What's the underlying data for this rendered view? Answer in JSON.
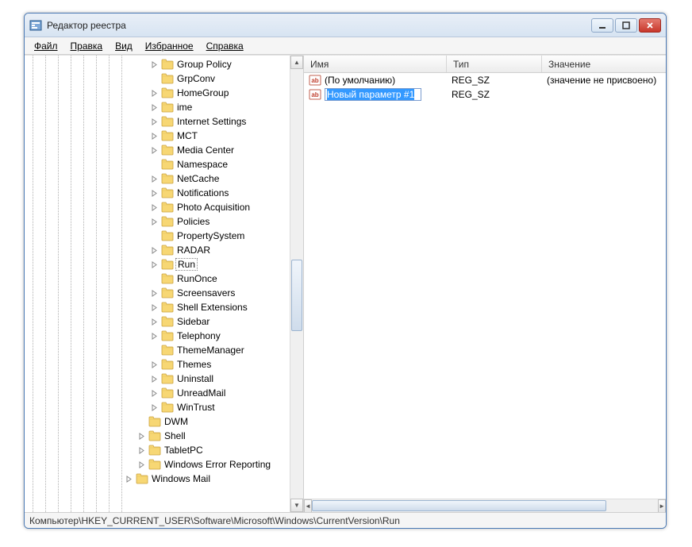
{
  "window": {
    "title": "Редактор реестра"
  },
  "menu": {
    "file": "Файл",
    "edit": "Правка",
    "view": "Вид",
    "favorites": "Избранное",
    "help": "Справка"
  },
  "tree": {
    "items": [
      {
        "label": "Group Policy",
        "expandable": true,
        "level": 2
      },
      {
        "label": "GrpConv",
        "expandable": false,
        "level": 2
      },
      {
        "label": "HomeGroup",
        "expandable": true,
        "level": 2
      },
      {
        "label": "ime",
        "expandable": true,
        "level": 2
      },
      {
        "label": "Internet Settings",
        "expandable": true,
        "level": 2
      },
      {
        "label": "MCT",
        "expandable": true,
        "level": 2
      },
      {
        "label": "Media Center",
        "expandable": true,
        "level": 2
      },
      {
        "label": "Namespace",
        "expandable": false,
        "level": 2
      },
      {
        "label": "NetCache",
        "expandable": true,
        "level": 2
      },
      {
        "label": "Notifications",
        "expandable": true,
        "level": 2
      },
      {
        "label": "Photo Acquisition",
        "expandable": true,
        "level": 2
      },
      {
        "label": "Policies",
        "expandable": true,
        "level": 2
      },
      {
        "label": "PropertySystem",
        "expandable": false,
        "level": 2
      },
      {
        "label": "RADAR",
        "expandable": true,
        "level": 2
      },
      {
        "label": "Run",
        "expandable": true,
        "level": 2,
        "selected": true
      },
      {
        "label": "RunOnce",
        "expandable": false,
        "level": 2
      },
      {
        "label": "Screensavers",
        "expandable": true,
        "level": 2
      },
      {
        "label": "Shell Extensions",
        "expandable": true,
        "level": 2
      },
      {
        "label": "Sidebar",
        "expandable": true,
        "level": 2
      },
      {
        "label": "Telephony",
        "expandable": true,
        "level": 2
      },
      {
        "label": "ThemeManager",
        "expandable": false,
        "level": 2
      },
      {
        "label": "Themes",
        "expandable": true,
        "level": 2
      },
      {
        "label": "Uninstall",
        "expandable": true,
        "level": 2
      },
      {
        "label": "UnreadMail",
        "expandable": true,
        "level": 2
      },
      {
        "label": "WinTrust",
        "expandable": true,
        "level": 2
      },
      {
        "label": "DWM",
        "expandable": false,
        "level": 1
      },
      {
        "label": "Shell",
        "expandable": true,
        "level": 1
      },
      {
        "label": "TabletPC",
        "expandable": true,
        "level": 1
      },
      {
        "label": "Windows Error Reporting",
        "expandable": true,
        "level": 1
      },
      {
        "label": "Windows Mail",
        "expandable": true,
        "level": 0
      }
    ]
  },
  "list": {
    "columns": {
      "name": "Имя",
      "type": "Тип",
      "value": "Значение"
    },
    "rows": [
      {
        "name": "(По умолчанию)",
        "type": "REG_SZ",
        "value": "(значение не присвоено)"
      },
      {
        "name": "Новый параметр #1",
        "type": "REG_SZ",
        "value": "",
        "editing": true
      }
    ]
  },
  "statusbar": {
    "path": "Компьютер\\HKEY_CURRENT_USER\\Software\\Microsoft\\Windows\\CurrentVersion\\Run"
  }
}
